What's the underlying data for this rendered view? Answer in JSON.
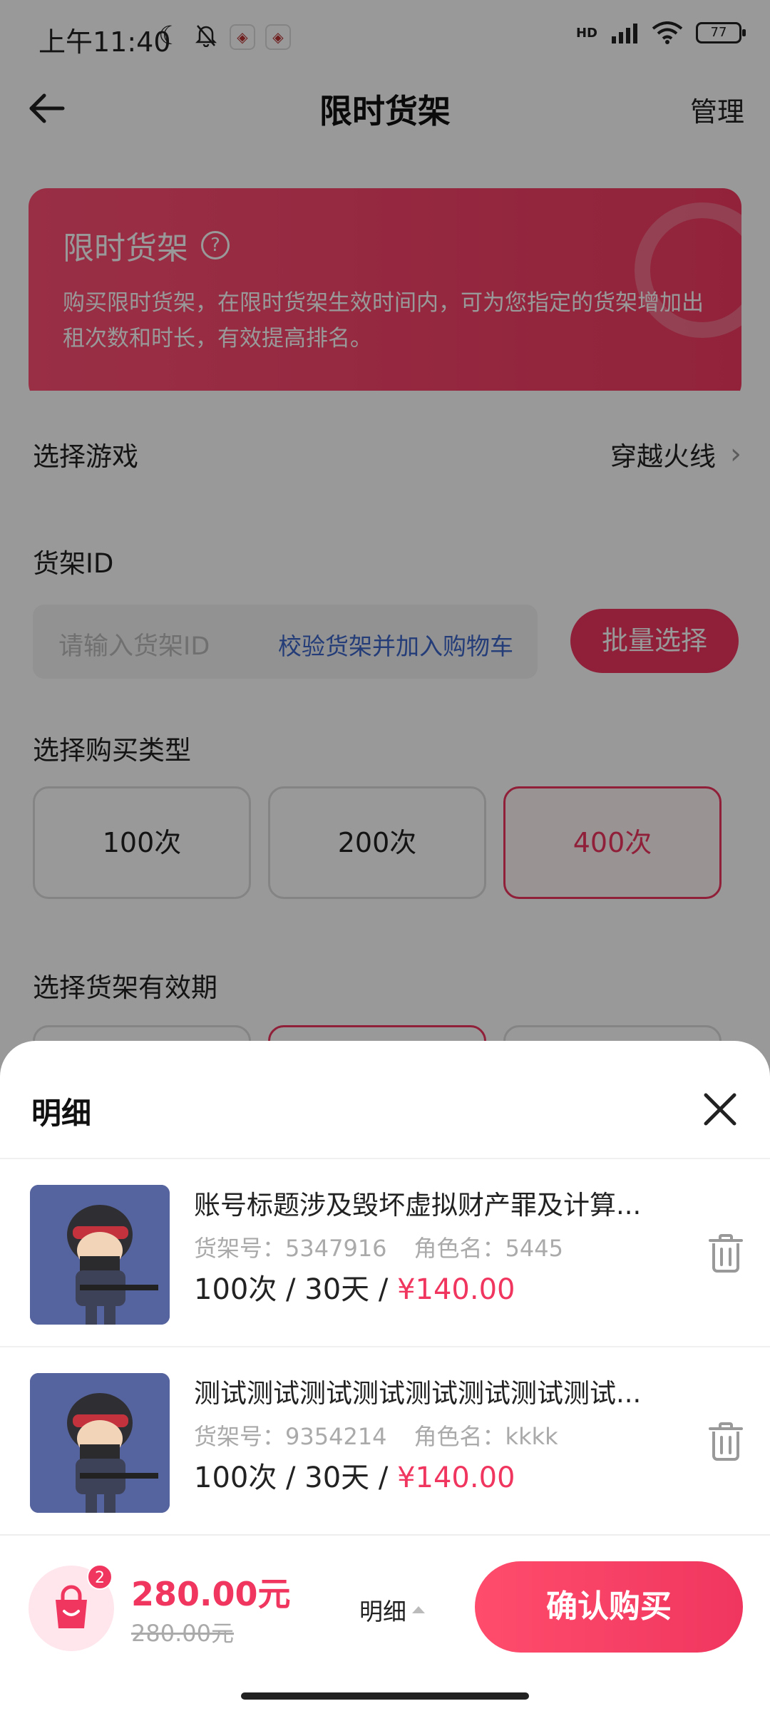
{
  "status_bar": {
    "time": "上午11:40",
    "network": "HD",
    "battery": "77"
  },
  "nav": {
    "title": "限时货架",
    "manage_label": "管理"
  },
  "banner": {
    "title": "限时货架",
    "description": "购买限时货架，在限时货架生效时间内，可为您指定的货架增加出租次数和时长，有效提高排名。"
  },
  "form": {
    "game_label": "选择游戏",
    "game_value": "穿越火线",
    "shelf_id_label": "货架ID",
    "shelf_id_placeholder": "请输入货架ID",
    "verify_label": "校验货架并加入购物车",
    "batch_select_label": "批量选择",
    "purchase_type_label": "选择购买类型",
    "purchase_types": [
      "100次",
      "200次",
      "400次"
    ],
    "selected_purchase_type": "400次",
    "validity_label": "选择货架有效期"
  },
  "sheet": {
    "title": "明细",
    "items": [
      {
        "title": "账号标题涉及毁坏虚拟财产罪及计算...",
        "shelf_no_label": "货架号：",
        "shelf_no": "5347916",
        "role_label": "角色名：",
        "role": "5445",
        "spec": "100次 / 30天 / ",
        "price": "¥140.00"
      },
      {
        "title": "测试测试测试测试测试测试测试测试...",
        "shelf_no_label": "货架号：",
        "shelf_no": "9354214",
        "role_label": "角色名：",
        "role": "kkkk",
        "spec": "100次 / 30天 / ",
        "price": "¥140.00"
      }
    ]
  },
  "footer": {
    "cart_count": "2",
    "total": "280.00元",
    "original_total": "280.00元",
    "detail_label": "明细",
    "confirm_label": "确认购买"
  },
  "colors": {
    "accent": "#f0365f",
    "link": "#3c67c9"
  }
}
